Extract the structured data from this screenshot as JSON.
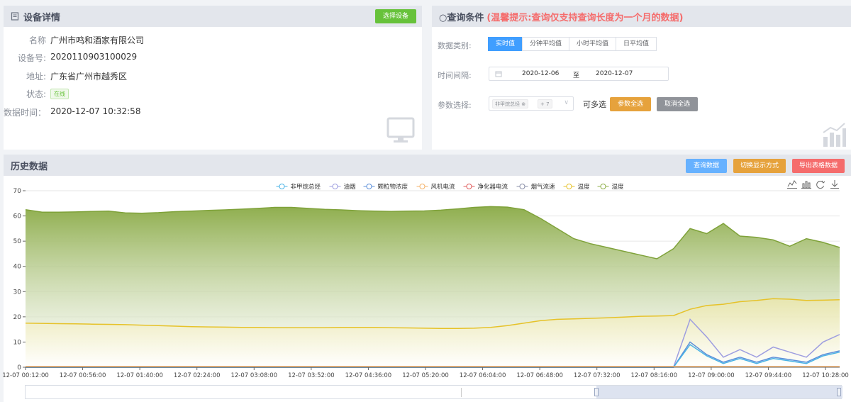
{
  "device": {
    "title": "设备详情",
    "select_button": "选择设备",
    "rows": [
      {
        "label": "名称",
        "value": "广州市鸣和酒家有限公司"
      },
      {
        "label": "设备号:",
        "value": "2020110903100029"
      },
      {
        "label": "地址:",
        "value": "广东省广州市越秀区"
      },
      {
        "label": "状态:",
        "value": ""
      },
      {
        "label": "数据时间：",
        "value": "2020-12-07 10:32:58"
      }
    ],
    "status_badge": "在线"
  },
  "query": {
    "title": "○查询条件",
    "hint": "(温馨提示:查询仅支持查询长度为一个月的数据)",
    "type_label": "数据类别:",
    "tabs": [
      "实时值",
      "分钟平均值",
      "小时平均值",
      "日平均值"
    ],
    "interval_label": "时间间隔:",
    "start_date": "2020-12-06",
    "range_sep": "至",
    "end_date": "2020-12-07",
    "param_label": "参数选择:",
    "chip_label": "非甲烷总烃",
    "chip_more": "+ 7",
    "multi_hint": "可多选",
    "select_all": "参数全选",
    "deselect_all": "取消全选"
  },
  "history": {
    "title": "历史数据",
    "btn_query": "查询数据",
    "btn_switch": "切换显示方式",
    "btn_export": "导出表格数据"
  },
  "colors": {
    "primary": "#409eff",
    "green": "#67c23a",
    "orange": "#e6a23c",
    "red": "#f56c6c",
    "gray": "#909399",
    "hint_red": "#f56c6c"
  },
  "chart_data": {
    "type": "area",
    "legend": [
      "非甲烷总烃",
      "油烟",
      "颗粒物浓度",
      "风机电流",
      "净化器电流",
      "烟气流速",
      "温度",
      "湿度"
    ],
    "legend_colors": [
      "#4ab3e6",
      "#9e9ee0",
      "#5c8fd9",
      "#f5b36b",
      "#e05c5c",
      "#8a8fa8",
      "#e6c229",
      "#8fb04a"
    ],
    "legend_position": "top",
    "x_ticks": [
      "12-07 00:12:00",
      "12-07 00:56:00",
      "12-07 01:40:00",
      "12-07 02:24:00",
      "12-07 03:08:00",
      "12-07 03:52:00",
      "12-07 04:36:00",
      "12-07 05:20:00",
      "12-07 06:04:00",
      "12-07 06:48:00",
      "12-07 07:32:00",
      "12-07 08:16:00",
      "12-07 09:00:00",
      "12-07 09:44:00",
      "12-07 10:28:00"
    ],
    "y_ticks": [
      0,
      10,
      20,
      30,
      40,
      50,
      60,
      70
    ],
    "ylim": [
      0,
      70
    ],
    "grid": true,
    "series": [
      {
        "name": "湿度",
        "values": [
          62.5,
          61.5,
          61.5,
          61.6,
          61.8,
          61.9,
          61.2,
          61.1,
          61.3,
          61.7,
          61.9,
          62.2,
          62.4,
          62.7,
          63.0,
          63.4,
          63.4,
          63.0,
          62.6,
          62.4,
          62.1,
          61.9,
          61.8,
          61.9,
          62.0,
          62.3,
          62.8,
          63.4,
          63.7,
          63.5,
          62.5,
          59.0,
          55.0,
          51.0,
          49.0,
          47.5,
          46.0,
          44.5,
          43.0,
          47.0,
          55.0,
          53.0,
          57.0,
          52.0,
          51.5,
          50.5,
          48.0,
          51.0,
          49.5,
          47.5
        ]
      },
      {
        "name": "温度",
        "values": [
          17.5,
          17.4,
          17.3,
          17.2,
          17.1,
          17.0,
          16.9,
          16.7,
          16.5,
          16.3,
          16.1,
          16.0,
          15.9,
          15.8,
          15.8,
          15.7,
          15.7,
          15.7,
          15.7,
          15.8,
          15.8,
          15.8,
          15.7,
          15.6,
          15.5,
          15.4,
          15.4,
          15.5,
          15.8,
          16.5,
          17.5,
          18.5,
          19.0,
          19.2,
          19.4,
          19.6,
          19.9,
          20.2,
          20.3,
          20.5,
          23.0,
          24.5,
          25.0,
          26.0,
          26.5,
          27.2,
          27.0,
          26.5,
          26.6,
          26.8
        ]
      },
      {
        "name": "油烟",
        "values": [
          0,
          0,
          0,
          0,
          0,
          0,
          0,
          0,
          0,
          0,
          0,
          0,
          0,
          0,
          0,
          0,
          0,
          0,
          0,
          0,
          0,
          0,
          0,
          0,
          0,
          0,
          0,
          0,
          0,
          0,
          0,
          0,
          0,
          0,
          0,
          0,
          0,
          0,
          0,
          0,
          19.0,
          12.0,
          4.0,
          7.0,
          4.0,
          8.0,
          6.0,
          4.0,
          10.0,
          13.0
        ]
      },
      {
        "name": "颗粒物浓度",
        "values": [
          0,
          0,
          0,
          0,
          0,
          0,
          0,
          0,
          0,
          0,
          0,
          0,
          0,
          0,
          0,
          0,
          0,
          0,
          0,
          0,
          0,
          0,
          0,
          0,
          0,
          0,
          0,
          0,
          0,
          0,
          0,
          0,
          0,
          0,
          0,
          0,
          0,
          0,
          0,
          0,
          10.0,
          5.0,
          2.0,
          4.0,
          2.0,
          4.0,
          3.0,
          2.0,
          5.0,
          6.5
        ]
      },
      {
        "name": "非甲烷总烃",
        "values": [
          0,
          0,
          0,
          0,
          0,
          0,
          0,
          0,
          0,
          0,
          0,
          0,
          0,
          0,
          0,
          0,
          0,
          0,
          0,
          0,
          0,
          0,
          0,
          0,
          0,
          0,
          0,
          0,
          0,
          0,
          0,
          0,
          0,
          0,
          0,
          0,
          0,
          0,
          0,
          0,
          9.0,
          4.5,
          1.5,
          3.5,
          1.5,
          3.5,
          2.5,
          1.5,
          4.5,
          6.0
        ]
      },
      {
        "name": "风机电流",
        "values": [
          0.3,
          0.3,
          0.3,
          0.3,
          0.3,
          0.3,
          0.3,
          0.3,
          0.3,
          0.3,
          0.3,
          0.3,
          0.3,
          0.3,
          0.3,
          0.3,
          0.3,
          0.3,
          0.3,
          0.3,
          0.3,
          0.3,
          0.3,
          0.3,
          0.3,
          0.3,
          0.3,
          0.3,
          0.3,
          0.3,
          0.3,
          0.3,
          0.3,
          0.3,
          0.3,
          0.3,
          0.3,
          0.3,
          0.3,
          0.3,
          0.3,
          0.3,
          0.3,
          0.3,
          0.3,
          0.3,
          0.3,
          0.3,
          0.3,
          0.3
        ]
      }
    ]
  }
}
